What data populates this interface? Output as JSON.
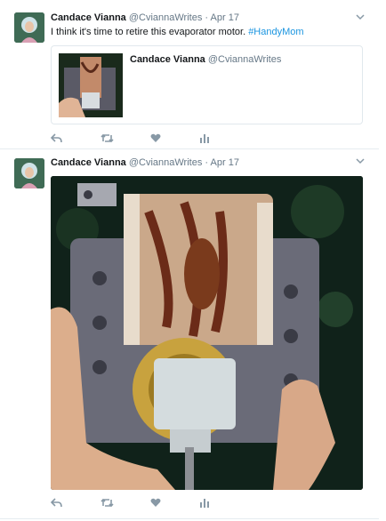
{
  "tweets": [
    {
      "author": {
        "name": "Candace Vianna",
        "handle": "@CviannaWrites"
      },
      "dot": "·",
      "date": "Apr 17",
      "text": "I think it's time to retire this evaporator motor. ",
      "hashtag": "#HandyMom",
      "quote": {
        "author": {
          "name": "Candace Vianna",
          "handle": "@CviannaWrites"
        }
      }
    },
    {
      "author": {
        "name": "Candace Vianna",
        "handle": "@CviannaWrites"
      },
      "dot": "·",
      "date": "Apr 17"
    }
  ],
  "icons": {
    "reply": "reply-icon",
    "retweet": "retweet-icon",
    "like": "heart-icon",
    "analytics": "analytics-icon",
    "caret": "chevron-down-icon"
  },
  "colors": {
    "link": "#1b95e0",
    "muted": "#657786",
    "icon": "#8899a6",
    "divider": "#e6ecf0"
  }
}
